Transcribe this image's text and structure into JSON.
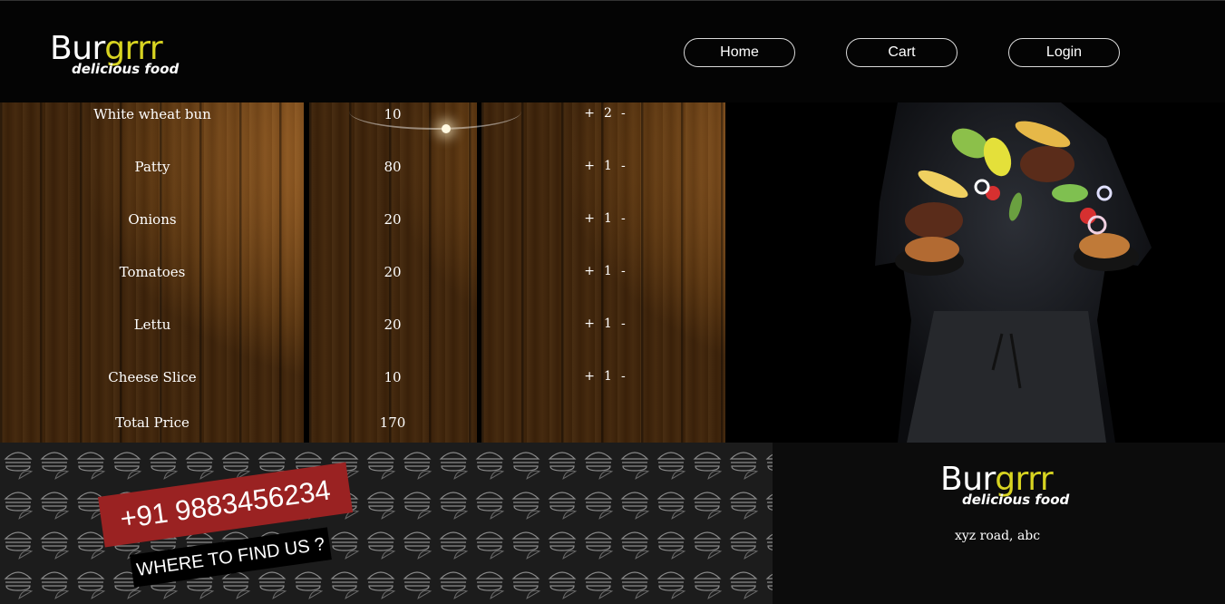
{
  "brand": {
    "name_part1": "Bur",
    "name_part2": "grrr",
    "tagline": "delicious food"
  },
  "nav": {
    "home": "Home",
    "cart": "Cart",
    "login": "Login"
  },
  "order": {
    "items": [
      {
        "name": "White wheat bun",
        "price": "10",
        "qty": "2"
      },
      {
        "name": "Patty",
        "price": "80",
        "qty": "1"
      },
      {
        "name": "Onions",
        "price": "20",
        "qty": "1"
      },
      {
        "name": "Tomatoes",
        "price": "20",
        "qty": "1"
      },
      {
        "name": "Lettu",
        "price": "20",
        "qty": "1"
      },
      {
        "name": "Cheese Slice",
        "price": "10",
        "qty": "1"
      }
    ],
    "total_label": "Total Price",
    "total_value": "170",
    "plus": "+",
    "minus": "-"
  },
  "footer": {
    "phone": "+91 9883456234",
    "find_us": "WHERE TO FIND US ?",
    "address": "xyz road, abc"
  },
  "colors": {
    "accent": "#d8d421",
    "phone_tag": "#9a2222"
  }
}
